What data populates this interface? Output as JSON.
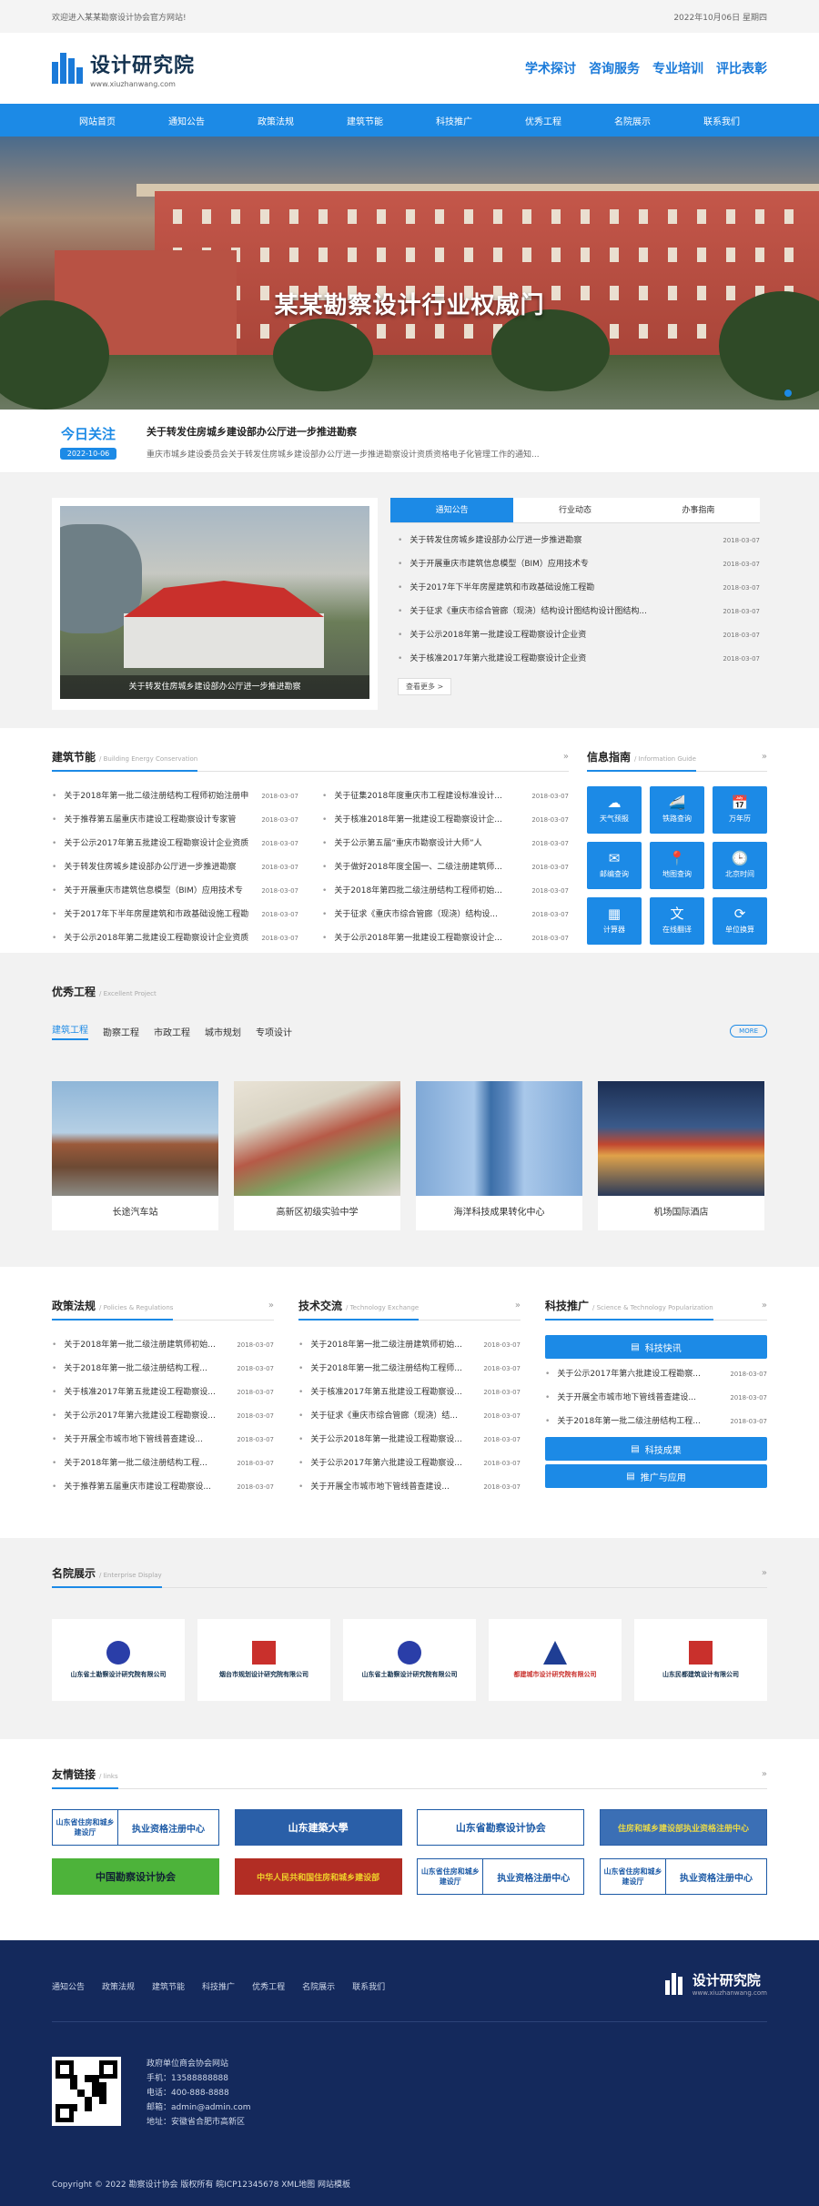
{
  "topbar": {
    "welcome": "欢迎进入某某勘察设计协会官方网站!",
    "date": "2022年10月06日 星期四"
  },
  "logo": {
    "title": "设计研究院",
    "sub": "www.xiuzhanwang.com"
  },
  "header_links": [
    "学术探讨",
    "咨询服务",
    "专业培训",
    "评比表彰"
  ],
  "nav": [
    "网站首页",
    "通知公告",
    "政策法规",
    "建筑节能",
    "科技推广",
    "优秀工程",
    "名院展示",
    "联系我们"
  ],
  "banner": {
    "title": "某某勘察设计行业权威门"
  },
  "today": {
    "label": "今日关注",
    "date": "2022-10-06",
    "headline": "关于转发住房城乡建设部办公厅进一步推进勘察",
    "summary": "重庆市城乡建设委员会关于转发住房城乡建设部办公厅进一步推进勘察设计资质资格电子化管理工作的通知..."
  },
  "feature": {
    "caption": "关于转发住房城乡建设部办公厅进一步推进勘察"
  },
  "news_tabs": [
    "通知公告",
    "行业动态",
    "办事指南"
  ],
  "news": [
    {
      "t": "关于转发住房城乡建设部办公厅进一步推进勘察",
      "d": "2018-03-07"
    },
    {
      "t": "关于开展重庆市建筑信息模型（BIM）应用技术专",
      "d": "2018-03-07"
    },
    {
      "t": "关于2017年下半年房屋建筑和市政基础设施工程勘",
      "d": "2018-03-07"
    },
    {
      "t": "关于征求《重庆市综合管廊（现浇）结构设计图结构设计图结构...",
      "d": "2018-03-07"
    },
    {
      "t": "关于公示2018年第一批建设工程勘察设计企业资",
      "d": "2018-03-07"
    },
    {
      "t": "关于核准2017年第六批建设工程勘察设计企业资",
      "d": "2018-03-07"
    }
  ],
  "news_more": "查看更多 >",
  "jznj": {
    "title": "建筑节能",
    "en": "/ Building Energy Conservation",
    "left": [
      {
        "t": "关于2018年第一批二级注册结构工程师初始注册申",
        "d": "2018-03-07"
      },
      {
        "t": "关于推荐第五届重庆市建设工程勘察设计专家管",
        "d": "2018-03-07"
      },
      {
        "t": "关于公示2017年第五批建设工程勘察设计企业资质",
        "d": "2018-03-07"
      },
      {
        "t": "关于转发住房城乡建设部办公厅进一步推进勘察",
        "d": "2018-03-07"
      },
      {
        "t": "关于开展重庆市建筑信息模型（BIM）应用技术专",
        "d": "2018-03-07"
      },
      {
        "t": "关于2017年下半年房屋建筑和市政基础设施工程勘",
        "d": "2018-03-07"
      },
      {
        "t": "关于公示2018年第二批建设工程勘察设计企业资质",
        "d": "2018-03-07"
      }
    ],
    "right": [
      {
        "t": "关于征集2018年度重庆市工程建设标准设计...",
        "d": "2018-03-07"
      },
      {
        "t": "关于核准2018年第一批建设工程勘察设计企...",
        "d": "2018-03-07"
      },
      {
        "t": "关于公示第五届“重庆市勘察设计大师”人",
        "d": "2018-03-07"
      },
      {
        "t": "关于做好2018年度全国一、二级注册建筑师...",
        "d": "2018-03-07"
      },
      {
        "t": "关于2018年第四批二级注册结构工程师初始...",
        "d": "2018-03-07"
      },
      {
        "t": "关于征求《重庆市综合管廊（现浇）结构设...",
        "d": "2018-03-07"
      },
      {
        "t": "关于公示2018年第一批建设工程勘察设计企...",
        "d": "2018-03-07"
      }
    ]
  },
  "info": {
    "title": "信息指南",
    "en": "/ Information Guide",
    "items": [
      {
        "ic": "☁",
        "l": "天气预报"
      },
      {
        "ic": "🚄",
        "l": "铁路查询"
      },
      {
        "ic": "📅",
        "l": "万年历"
      },
      {
        "ic": "✉",
        "l": "邮编查询"
      },
      {
        "ic": "📍",
        "l": "地图查询"
      },
      {
        "ic": "🕒",
        "l": "北京时间"
      },
      {
        "ic": "▦",
        "l": "计算器"
      },
      {
        "ic": "文",
        "l": "在线翻译"
      },
      {
        "ic": "⟳",
        "l": "单位换算"
      }
    ]
  },
  "projects": {
    "title": "优秀工程",
    "en": "/ Excellent Project",
    "tabs": [
      "建筑工程",
      "勘察工程",
      "市政工程",
      "城市规划",
      "专项设计"
    ],
    "more": "MORE",
    "items": [
      "长途汽车站",
      "高新区初级实验中学",
      "海洋科技成果转化中心",
      "机场国际酒店"
    ]
  },
  "policy": {
    "title": "政策法规",
    "en": "/ Policies & Regulations",
    "items": [
      {
        "t": "关于2018年第一批二级注册建筑师初始...",
        "d": "2018-03-07"
      },
      {
        "t": "关于2018年第一批二级注册结构工程...",
        "d": "2018-03-07"
      },
      {
        "t": "关于核准2017年第五批建设工程勘察设...",
        "d": "2018-03-07"
      },
      {
        "t": "关于公示2017年第六批建设工程勘察设...",
        "d": "2018-03-07"
      },
      {
        "t": "关于开展全市城市地下管线普查建设...",
        "d": "2018-03-07"
      },
      {
        "t": "关于2018年第一批二级注册结构工程...",
        "d": "2018-03-07"
      },
      {
        "t": "关于推荐第五届重庆市建设工程勘察设...",
        "d": "2018-03-07"
      }
    ]
  },
  "tech": {
    "title": "技术交流",
    "en": "/ Technology Exchange",
    "items": [
      {
        "t": "关于2018年第一批二级注册建筑师初始...",
        "d": "2018-03-07"
      },
      {
        "t": "关于2018年第一批二级注册结构工程师...",
        "d": "2018-03-07"
      },
      {
        "t": "关于核准2017年第五批建设工程勘察设...",
        "d": "2018-03-07"
      },
      {
        "t": "关于征求《重庆市综合管廊（现浇）结...",
        "d": "2018-03-07"
      },
      {
        "t": "关于公示2018年第一批建设工程勘察设...",
        "d": "2018-03-07"
      },
      {
        "t": "关于公示2017年第六批建设工程勘察设...",
        "d": "2018-03-07"
      },
      {
        "t": "关于开展全市城市地下管线普查建设...",
        "d": "2018-03-07"
      }
    ]
  },
  "promo": {
    "title": "科技推广",
    "en": "/ Science & Technology Popularization",
    "btn1": "科技快讯",
    "btn2": "科技成果",
    "btn3": "推广与应用",
    "items": [
      {
        "t": "关于公示2017年第六批建设工程勘察...",
        "d": "2018-03-07"
      },
      {
        "t": "关于开展全市城市地下管线普查建设...",
        "d": "2018-03-07"
      },
      {
        "t": "关于2018年第一批二级注册结构工程...",
        "d": "2018-03-07"
      }
    ]
  },
  "brands": {
    "title": "名院展示",
    "en": "/ Enterprise Display",
    "items": [
      "山东省土勘察设计研究院有限公司",
      "烟台市规划设计研究院有限公司",
      "山东省土勘察设计研究院有限公司",
      "都建城市设计研究院有限公司",
      "山东民都建筑设计有限公司"
    ]
  },
  "links": {
    "title": "友情链接",
    "en": "/ links",
    "items": [
      {
        "type": "split",
        "l": "山东省住房和城乡建设厅",
        "r": "执业资格注册中心"
      },
      {
        "type": "solid",
        "t": "山东建築大學"
      },
      {
        "type": "plain",
        "t": "山东省勘察设计协会"
      },
      {
        "type": "solid",
        "t": "住房和城乡建设部执业资格注册中心"
      },
      {
        "type": "green",
        "t": "中国勘察设计协会"
      },
      {
        "type": "red",
        "t": "中华人民共和国住房和城乡建设部"
      },
      {
        "type": "split",
        "l": "山东省住房和城乡建设厅",
        "r": "执业资格注册中心"
      },
      {
        "type": "split",
        "l": "山东省住房和城乡建设厅",
        "r": "执业资格注册中心"
      }
    ]
  },
  "footer": {
    "nav": [
      "通知公告",
      "政策法规",
      "建筑节能",
      "科技推广",
      "优秀工程",
      "名院展示",
      "联系我们"
    ],
    "logo": "设计研究院",
    "logo_sub": "www.xiuzhanwang.com",
    "org": "政府单位商会协会网站",
    "phone": "手机：13588888888",
    "tel": "电话：400-888-8888",
    "email": "邮箱：admin@admin.com",
    "addr": "地址：安徽省合肥市高新区",
    "copyright": "Copyright © 2022 勘察设计协会 版权所有 皖ICP12345678 XML地图 网站模板"
  }
}
